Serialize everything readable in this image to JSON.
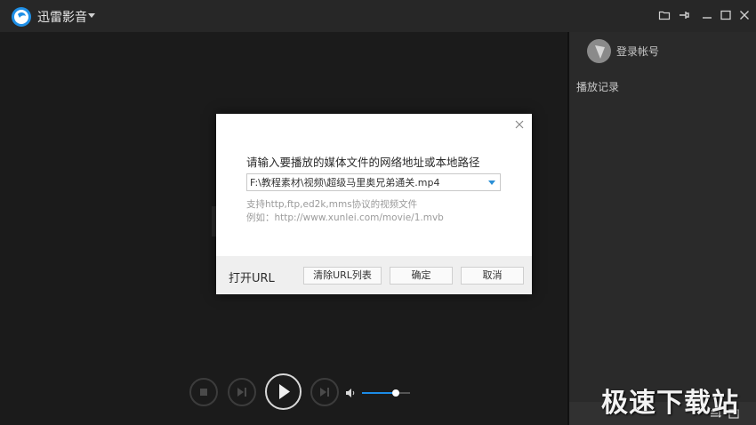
{
  "app": {
    "title": "迅雷影音"
  },
  "sidebar": {
    "login": "登录帐号",
    "history": "播放记录"
  },
  "dialog": {
    "heading": "请输入要播放的媒体文件的网络地址或本地路径",
    "url_value": "F:\\教程素材\\视频\\超级马里奥兄弟通关.mp4",
    "hint_line1": "支持http,ftp,ed2k,mms协议的视频文件",
    "hint_line2": "例如：http://www.xunlei.com/movie/1.mvb",
    "footer_label": "打开URL",
    "clear_button": "清除URL列表",
    "ok_button": "确定",
    "cancel_button": "取消"
  },
  "player": {
    "volume": 0.7
  },
  "watermark": "极速下载站",
  "colors": {
    "accent": "#1c8be6",
    "titlebar": "#272727",
    "sidebar": "#2a2a2a"
  }
}
